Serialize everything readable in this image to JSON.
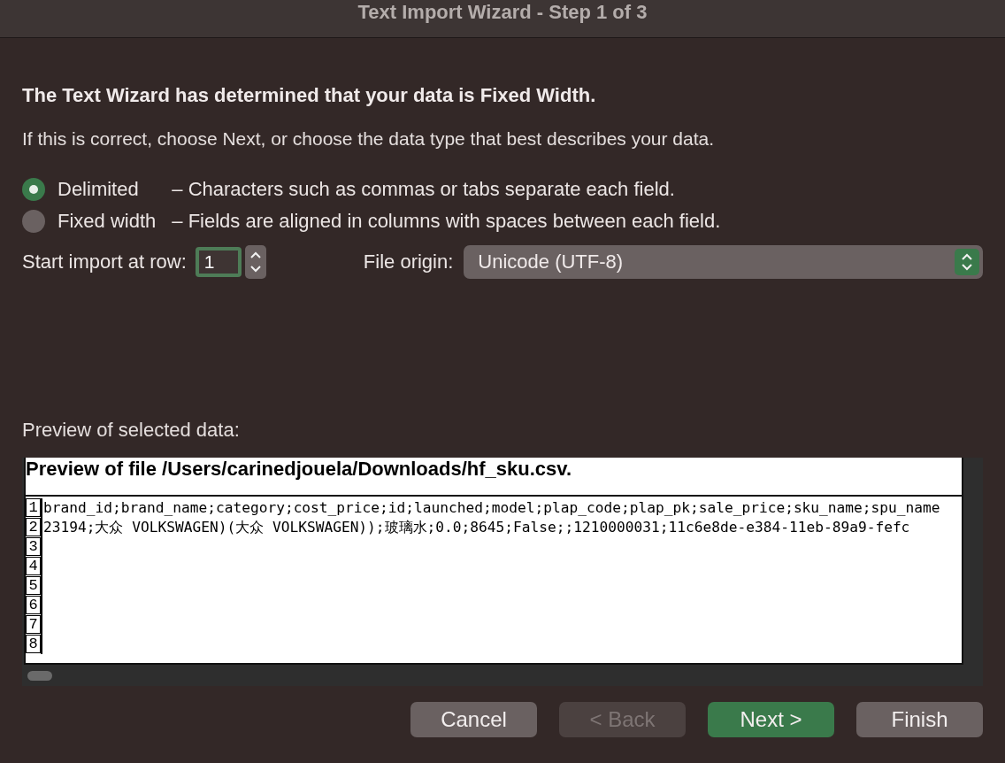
{
  "window": {
    "title": "Text Import Wizard - Step 1 of 3"
  },
  "heading": "The Text Wizard has determined that your data is Fixed Width.",
  "instruction": "If this is correct, choose Next, or choose the data type that best describes your data.",
  "data_types": [
    {
      "label": "Delimited",
      "description": "– Characters such as commas or tabs separate each field.",
      "selected": true
    },
    {
      "label": "Fixed width",
      "description": "– Fields are aligned in columns with spaces between each field.",
      "selected": false
    }
  ],
  "start_row": {
    "label": "Start import at row:",
    "value": "1"
  },
  "file_origin": {
    "label": "File origin:",
    "value": "Unicode (UTF-8)"
  },
  "preview": {
    "label": "Preview of selected data:",
    "file_title": "Preview of file /Users/carinedjouela/Downloads/hf_sku.csv.",
    "rows": [
      {
        "number": "1",
        "text": "brand_id;brand_name;category;cost_price;id;launched;model;plap_code;plap_pk;sale_price;sku_name;spu_name"
      },
      {
        "number": "2",
        "text": "23194;大众 VOLKSWAGEN)(大众 VOLKSWAGEN));玻璃水;0.0;8645;False;;1210000031;11c6e8de-e384-11eb-89a9-fefc"
      },
      {
        "number": "3"
      },
      {
        "number": "4"
      },
      {
        "number": "5"
      },
      {
        "number": "6"
      },
      {
        "number": "7"
      },
      {
        "number": "8"
      }
    ]
  },
  "buttons": [
    {
      "label": "Cancel",
      "kind": "normal",
      "disabled": false
    },
    {
      "label": "< Back",
      "kind": "normal",
      "disabled": true
    },
    {
      "label": "Next >",
      "kind": "default",
      "disabled": false
    },
    {
      "label": "Finish",
      "kind": "normal",
      "disabled": false
    }
  ]
}
